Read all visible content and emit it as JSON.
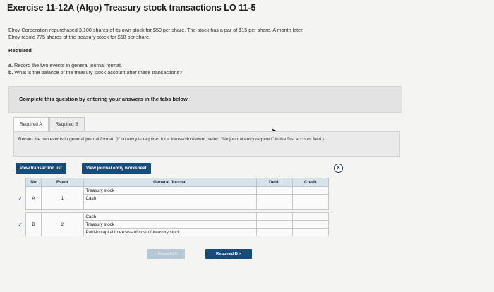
{
  "title": "Exercise 11-12A (Algo) Treasury stock transactions LO 11-5",
  "problem": {
    "line1": "Elroy Corporation repurchased 3,100 shares of its own stock for $50 per share. The stock has a par of $15 per share. A month later,",
    "line2": "Elroy resold 775 shares of the treasury stock for $58 per share."
  },
  "required_heading": "Required",
  "requirements": [
    {
      "label": "a.",
      "text": "Record the two events in general journal format."
    },
    {
      "label": "b.",
      "text": "What is the balance of the treasury stock account after these transactions?"
    }
  ],
  "instruction_box": "Complete this question by entering your answers in the tabs below.",
  "tabs": [
    {
      "label": "Required A",
      "active": true
    },
    {
      "label": "Required B",
      "active": false
    }
  ],
  "panel_text": "Record the two events in general journal format. (If no entry is required for a transaction/event, select \"No journal entry required\" in the first account field.)",
  "buttons": {
    "view_transactions": "View transaction list",
    "view_journal": "View journal entry worksheet",
    "prev": "< Required A",
    "next": "Required B  >"
  },
  "table": {
    "headers": {
      "no": "No",
      "event": "Event",
      "journal": "General Journal",
      "debit": "Debit",
      "credit": "Credit"
    },
    "entries": [
      {
        "check": "✓",
        "no": "A",
        "event": "1",
        "rows": [
          "Treasury stock",
          "Cash"
        ]
      },
      {
        "check": "✓",
        "no": "B",
        "event": "2",
        "rows": [
          "Cash",
          "Treasury stock",
          "Paid-in capital in excess of cost of treasury stock"
        ]
      }
    ]
  },
  "colors": {
    "accent": "#164c7a",
    "header_bg": "#d7e2ea"
  }
}
